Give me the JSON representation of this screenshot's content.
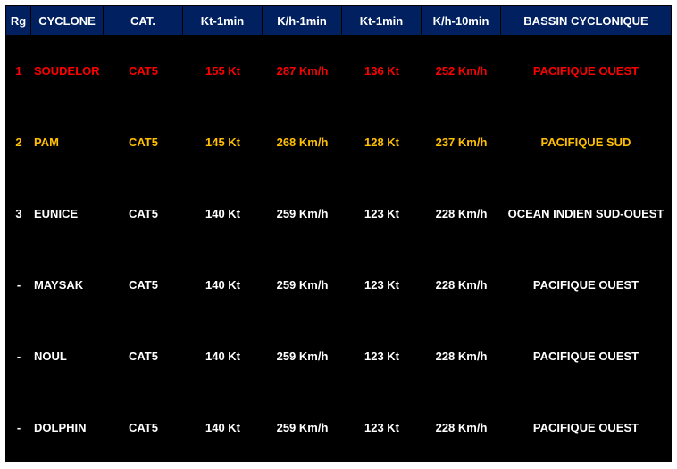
{
  "colors": {
    "header_bg": "#002060",
    "rank1": "#ff0000",
    "rank2": "#ffc000",
    "default": "#ffffff"
  },
  "headers": [
    "Rg",
    "CYCLONE",
    "CAT.",
    "Kt-1min",
    "K/h-1min",
    "Kt-1min",
    "K/h-10min",
    "BASSIN CYCLONIQUE"
  ],
  "rows": [
    {
      "rg": "1",
      "name": "SOUDELOR",
      "cat": "CAT5",
      "kt1": "155 Kt",
      "kh1": "287 Km/h",
      "kt10": "136 Kt",
      "kh10": "252 Km/h",
      "basin": "PACIFIQUE OUEST",
      "color": "#ff0000"
    },
    {
      "rg": "2",
      "name": "PAM",
      "cat": "CAT5",
      "kt1": "145 Kt",
      "kh1": "268 Km/h",
      "kt10": "128 Kt",
      "kh10": "237 Km/h",
      "basin": "PACIFIQUE SUD",
      "color": "#ffc000"
    },
    {
      "rg": "3",
      "name": "EUNICE",
      "cat": "CAT5",
      "kt1": "140 Kt",
      "kh1": "259 Km/h",
      "kt10": "123 Kt",
      "kh10": "228 Km/h",
      "basin": "OCEAN INDIEN SUD-OUEST",
      "color": "#ffffff"
    },
    {
      "rg": "-",
      "name": "MAYSAK",
      "cat": "CAT5",
      "kt1": "140 Kt",
      "kh1": "259 Km/h",
      "kt10": "123 Kt",
      "kh10": "228 Km/h",
      "basin": "PACIFIQUE OUEST",
      "color": "#ffffff"
    },
    {
      "rg": "-",
      "name": "NOUL",
      "cat": "CAT5",
      "kt1": "140 Kt",
      "kh1": "259 Km/h",
      "kt10": "123 Kt",
      "kh10": "228 Km/h",
      "basin": "PACIFIQUE OUEST",
      "color": "#ffffff"
    },
    {
      "rg": "-",
      "name": "DOLPHIN",
      "cat": "CAT5",
      "kt1": "140 Kt",
      "kh1": "259 Km/h",
      "kt10": "123 Kt",
      "kh10": "228 Km/h",
      "basin": "PACIFIQUE OUEST",
      "color": "#ffffff"
    }
  ]
}
